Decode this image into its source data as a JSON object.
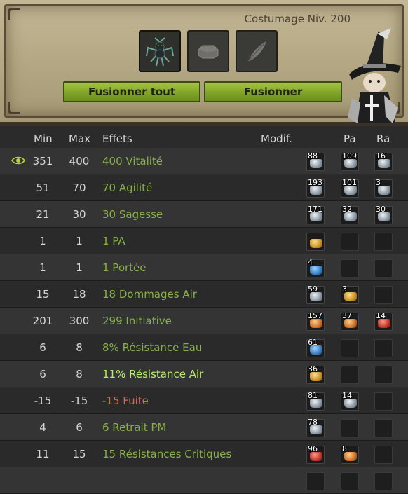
{
  "header": {
    "costumage_label": "Costumage Niv. 200",
    "slots": [
      {
        "icon": "spider-creature-icon",
        "state": "filled"
      },
      {
        "icon": "octagon-rune-icon",
        "state": "placeholder"
      },
      {
        "icon": "feather-icon",
        "state": "placeholder"
      }
    ],
    "buttons": {
      "fuse_all": "Fusionner tout",
      "fuse": "Fusionner"
    },
    "mascot_icon": "wizard-character-icon"
  },
  "table": {
    "columns": {
      "min": "Min",
      "max": "Max",
      "effets": "Effets",
      "modif": "Modif.",
      "pa": "Pa",
      "ra": "Ra"
    },
    "rows": [
      {
        "min": "351",
        "max": "400",
        "effect": "400 Vitalité",
        "style": "normal",
        "eye": true,
        "runes": [
          {
            "qty": "88",
            "gem": "silver"
          },
          {
            "qty": "109",
            "gem": "silver"
          },
          {
            "qty": "16",
            "gem": "silver"
          }
        ]
      },
      {
        "min": "51",
        "max": "70",
        "effect": "70 Agilité",
        "style": "normal",
        "runes": [
          {
            "qty": "193",
            "gem": "silver"
          },
          {
            "qty": "101",
            "gem": "silver"
          },
          {
            "qty": "3",
            "gem": "silver"
          }
        ]
      },
      {
        "min": "21",
        "max": "30",
        "effect": "30 Sagesse",
        "style": "normal",
        "runes": [
          {
            "qty": "171",
            "gem": "silver"
          },
          {
            "qty": "32",
            "gem": "silver"
          },
          {
            "qty": "30",
            "gem": "silver"
          }
        ]
      },
      {
        "min": "1",
        "max": "1",
        "effect": "1 PA",
        "style": "normal",
        "runes": [
          {
            "qty": "",
            "gem": "gold"
          },
          null,
          null
        ]
      },
      {
        "min": "1",
        "max": "1",
        "effect": "1 Portée",
        "style": "normal",
        "runes": [
          {
            "qty": "4",
            "gem": "blue"
          },
          null,
          null
        ]
      },
      {
        "min": "15",
        "max": "18",
        "effect": "18 Dommages Air",
        "style": "normal",
        "runes": [
          {
            "qty": "59",
            "gem": "silver"
          },
          {
            "qty": "3",
            "gem": "gold"
          },
          null
        ]
      },
      {
        "min": "201",
        "max": "300",
        "effect": "299 Initiative",
        "style": "normal",
        "runes": [
          {
            "qty": "157",
            "gem": "orange"
          },
          {
            "qty": "37",
            "gem": "orange"
          },
          {
            "qty": "14",
            "gem": "red"
          }
        ]
      },
      {
        "min": "6",
        "max": "8",
        "effect": "8% Résistance Eau",
        "style": "normal",
        "runes": [
          {
            "qty": "61",
            "gem": "blue"
          },
          null,
          null
        ]
      },
      {
        "min": "6",
        "max": "8",
        "effect": "11% Résistance Air",
        "style": "bright",
        "runes": [
          {
            "qty": "36",
            "gem": "gold"
          },
          null,
          null
        ]
      },
      {
        "min": "-15",
        "max": "-15",
        "effect": "-15 Fuite",
        "style": "neg",
        "runes": [
          {
            "qty": "81",
            "gem": "silver"
          },
          {
            "qty": "14",
            "gem": "silver"
          },
          null
        ]
      },
      {
        "min": "4",
        "max": "6",
        "effect": "6 Retrait PM",
        "style": "normal",
        "runes": [
          {
            "qty": "78",
            "gem": "silver"
          },
          null,
          null
        ]
      },
      {
        "min": "11",
        "max": "15",
        "effect": "15 Résistances Critiques",
        "style": "normal",
        "runes": [
          {
            "qty": "96",
            "gem": "red"
          },
          {
            "qty": "8",
            "gem": "orange"
          },
          null
        ]
      },
      {
        "min": "",
        "max": "",
        "effect": "",
        "style": "normal",
        "runes": [
          null,
          null,
          null
        ]
      }
    ]
  }
}
